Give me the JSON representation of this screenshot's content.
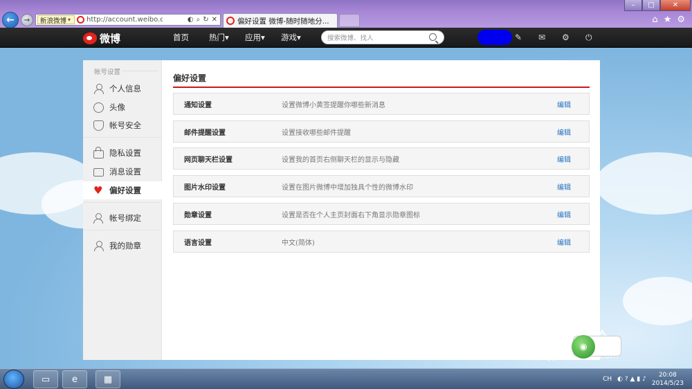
{
  "browser": {
    "address_tag": "新浪微博",
    "url": "http://account.weibo.com/s",
    "tab_title": "偏好设置 微博-随时随地分..."
  },
  "weibo_nav": {
    "logo_text": "微博",
    "items": [
      "首页",
      "热门▾",
      "应用▾",
      "游戏▾"
    ],
    "search_placeholder": "搜索微博、找人"
  },
  "sidebar": {
    "title": "帐号设置",
    "items": [
      {
        "label": "个人信息",
        "icon": "person-icon"
      },
      {
        "label": "头像",
        "icon": "avatar-icon"
      },
      {
        "label": "帐号安全",
        "icon": "shield-icon"
      },
      {
        "label": "隐私设置",
        "icon": "lock-icon"
      },
      {
        "label": "消息设置",
        "icon": "message-icon"
      },
      {
        "label": "偏好设置",
        "icon": "heart-icon",
        "active": true
      },
      {
        "label": "帐号绑定",
        "icon": "bind-icon"
      },
      {
        "label": "我的勋章",
        "icon": "medal-icon"
      }
    ]
  },
  "main": {
    "title": "偏好设置",
    "edit_label": "编辑",
    "rows": [
      {
        "label": "通知设置",
        "desc": "设置微博小黄签提醒你哪些新消息"
      },
      {
        "label": "邮件提醒设置",
        "desc": "设置接收哪些邮件提醒"
      },
      {
        "label": "网页聊天栏设置",
        "desc": "设置我的首页右侧聊天栏的显示与隐藏"
      },
      {
        "label": "图片水印设置",
        "desc": "设置在图片微博中增加独具个性的微博水印"
      },
      {
        "label": "勋章设置",
        "desc": "设置是否在个人主页封面右下角显示勋章图标"
      },
      {
        "label": "语言设置",
        "desc": "中文(简体)"
      }
    ]
  },
  "taskbar": {
    "lang": "CH",
    "time": "20:08",
    "date": "2014/5/23"
  },
  "watermark": {
    "big": "Bai 经验",
    "small": "jingyan.baidu.com"
  },
  "colors": {
    "accent_red": "#c8171e",
    "link_blue": "#2674c4"
  }
}
